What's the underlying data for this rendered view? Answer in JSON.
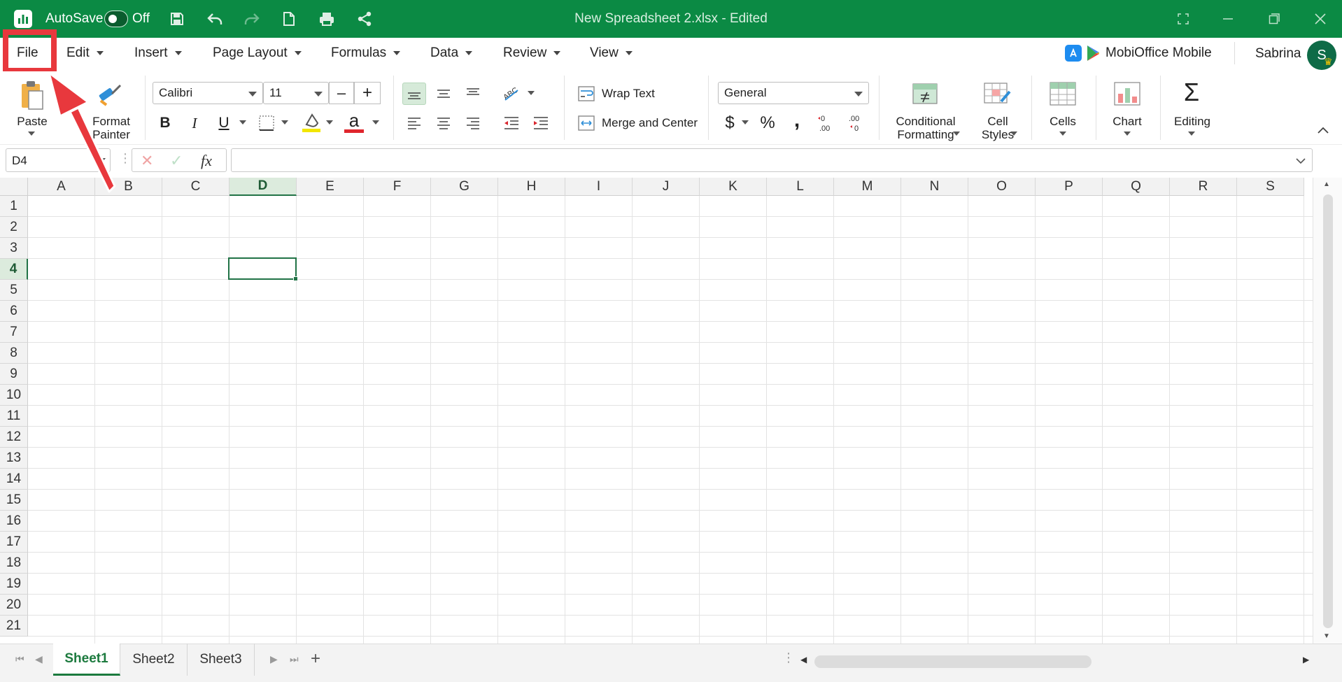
{
  "titlebar": {
    "autosave_label": "AutoSave",
    "autosave_state": "Off",
    "document_title": "New Spreadsheet 2.xlsx - Edited"
  },
  "menu": {
    "items": [
      "File",
      "Edit",
      "Insert",
      "Page Layout",
      "Formulas",
      "Data",
      "Review",
      "View"
    ],
    "promo": "MobiOffice Mobile",
    "user_name": "Sabrina",
    "avatar_initial": "S"
  },
  "ribbon": {
    "paste": "Paste",
    "format_painter": [
      "Format",
      "Painter"
    ],
    "font_name": "Calibri",
    "font_size": "11",
    "decrease": "–",
    "increase": "+",
    "bold": "B",
    "italic": "I",
    "underline": "U",
    "font_color_glyph": "a",
    "wrap_text": "Wrap Text",
    "merge_center": "Merge and Center",
    "number_format": "General",
    "currency": "$",
    "percent": "%",
    "comma": ",",
    "conditional_formatting": [
      "Conditional",
      "Formatting"
    ],
    "cell_styles": [
      "Cell",
      "Styles"
    ],
    "cells": "Cells",
    "chart": "Chart",
    "editing": "Editing",
    "editing_glyph": "Σ"
  },
  "formula_bar": {
    "name_box": "D4",
    "fx": "fx",
    "formula": ""
  },
  "grid": {
    "columns": [
      "A",
      "B",
      "C",
      "D",
      "E",
      "F",
      "G",
      "H",
      "I",
      "J",
      "K",
      "L",
      "M",
      "N",
      "O",
      "P",
      "Q",
      "R",
      "S"
    ],
    "rows": [
      "1",
      "2",
      "3",
      "4",
      "5",
      "6",
      "7",
      "8",
      "9",
      "10",
      "11",
      "12",
      "13",
      "14",
      "15",
      "16",
      "17",
      "18",
      "19",
      "20",
      "21"
    ],
    "active_column": "D",
    "active_row": "4"
  },
  "sheets": {
    "tabs": [
      "Sheet1",
      "Sheet2",
      "Sheet3"
    ],
    "active": "Sheet1",
    "add": "+"
  },
  "colors": {
    "title_bar": "#0b8a44",
    "accent": "#217346",
    "annotation": "#e8383d"
  }
}
